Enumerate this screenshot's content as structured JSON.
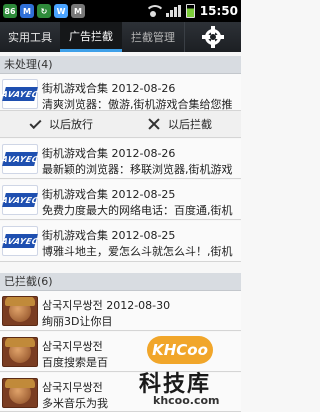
{
  "status_bar": {
    "icons": [
      "86",
      "M",
      "↻",
      "W",
      "M"
    ],
    "time": "15:50"
  },
  "tabs": [
    {
      "label": "实用工具"
    },
    {
      "label": "广告拦截"
    },
    {
      "label": "拦截管理"
    }
  ],
  "pending": {
    "header": "未处理(4)",
    "items": [
      {
        "thumb": "AVAYEC",
        "title": "街机游戏合集 2012-08-26",
        "desc": "清爽浏览器：傲游,街机游戏合集给您推"
      },
      {
        "thumb": "AVAYEC",
        "title": "街机游戏合集 2012-08-26",
        "desc": "最新颖的浏览器：移联浏览器,街机游戏"
      },
      {
        "thumb": "AVAYEC",
        "title": "街机游戏合集 2012-08-25",
        "desc": "免费力度最大的网络电话：百度通,街机"
      },
      {
        "thumb": "AVAYEC",
        "title": "街机游戏合集 2012-08-25",
        "desc": "博雅斗地主，爱怎么斗就怎么斗！,街机"
      }
    ],
    "allow_label": "以后放行",
    "block_label": "以后拦截"
  },
  "blocked": {
    "header": "已拦截(6)",
    "items": [
      {
        "title": "삼국지무쌍전 2012-08-30",
        "desc": "绚丽3D让你目"
      },
      {
        "title": "삼국지무쌍전",
        "desc": "百度搜索是百"
      },
      {
        "title": "삼국지무쌍전",
        "desc": "多米音乐为我"
      }
    ]
  },
  "watermark": {
    "logo": "KHCoo",
    "title": "科技库",
    "url": "khcoo.com"
  }
}
